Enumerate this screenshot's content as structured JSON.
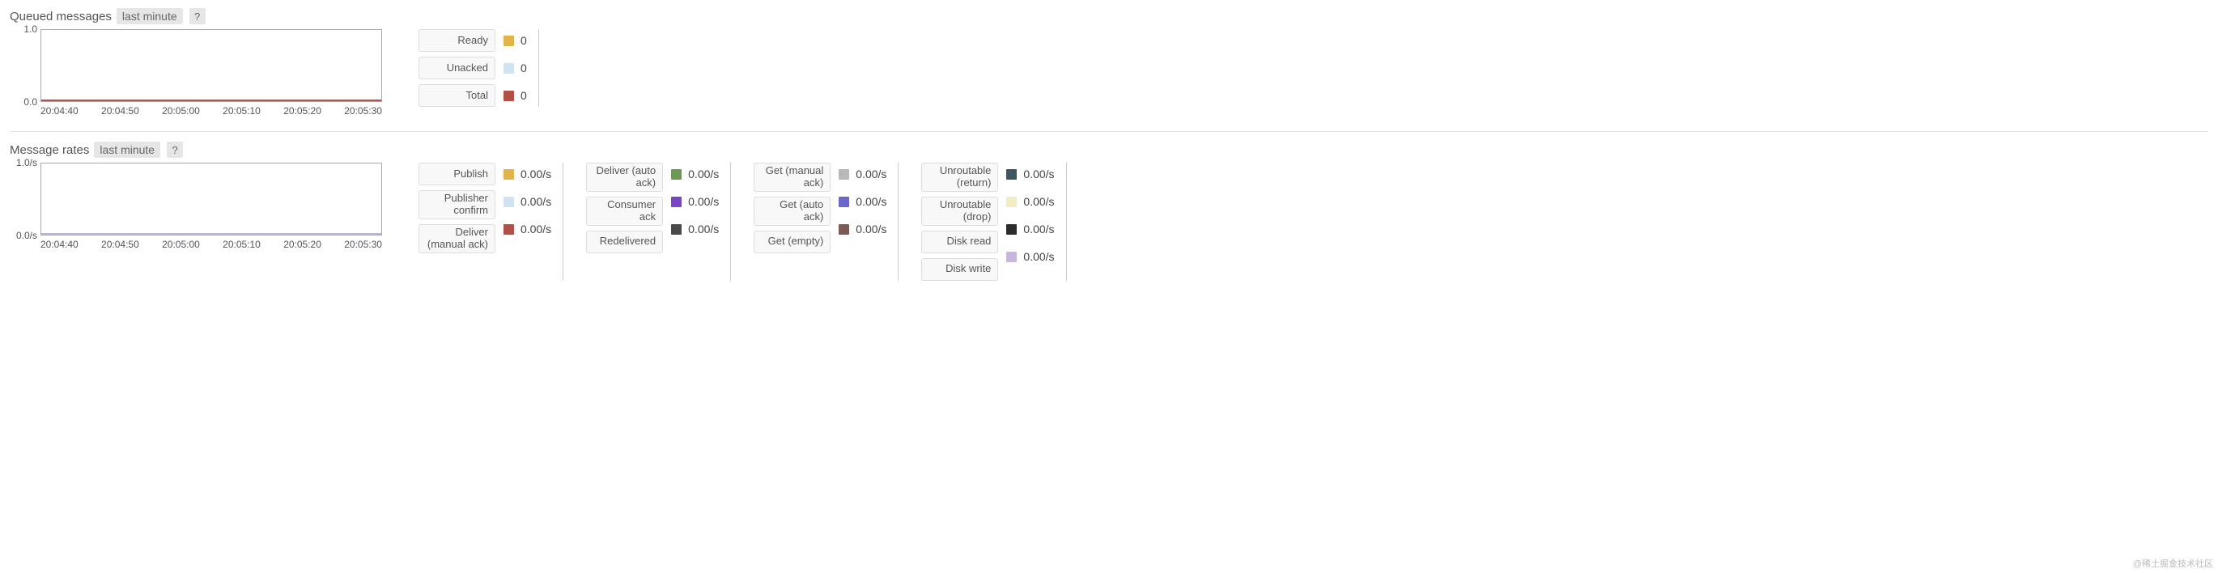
{
  "queued": {
    "title": "Queued messages",
    "range_tag": "last minute",
    "help": "?",
    "y_top": "1.0",
    "y_bottom": "0.0",
    "x_ticks": [
      "20:04:40",
      "20:04:50",
      "20:05:00",
      "20:05:10",
      "20:05:20",
      "20:05:30"
    ],
    "legend": [
      {
        "label": "Ready",
        "value": "0",
        "color": "#e1b44b"
      },
      {
        "label": "Unacked",
        "value": "0",
        "color": "#cfe3f0"
      },
      {
        "label": "Total",
        "value": "0",
        "color": "#b35045"
      }
    ]
  },
  "rates": {
    "title": "Message rates",
    "range_tag": "last minute",
    "help": "?",
    "y_top": "1.0/s",
    "y_bottom": "0.0/s",
    "x_ticks": [
      "20:04:40",
      "20:04:50",
      "20:05:00",
      "20:05:10",
      "20:05:20",
      "20:05:30"
    ],
    "columns": [
      [
        {
          "label": "Publish",
          "value": "0.00/s",
          "color": "#e1b44b"
        },
        {
          "label": "Publisher confirm",
          "value": "0.00/s",
          "color": "#cfe3f0"
        },
        {
          "label": "Deliver (manual ack)",
          "value": "0.00/s",
          "color": "#b35045"
        }
      ],
      [
        {
          "label": "Deliver (auto ack)",
          "value": "0.00/s",
          "color": "#6a9a4e"
        },
        {
          "label": "Consumer ack",
          "value": "0.00/s",
          "color": "#7a45c9"
        },
        {
          "label": "Redelivered",
          "value": "0.00/s",
          "color": "#4a4a4a"
        }
      ],
      [
        {
          "label": "Get (manual ack)",
          "value": "0.00/s",
          "color": "#b8b8b8"
        },
        {
          "label": "Get (auto ack)",
          "value": "0.00/s",
          "color": "#6b66c9"
        },
        {
          "label": "Get (empty)",
          "value": "0.00/s",
          "color": "#7d5a52"
        }
      ],
      [
        {
          "label": "Unroutable (return)",
          "value": "0.00/s",
          "color": "#3f5660"
        },
        {
          "label": "Unroutable (drop)",
          "value": "0.00/s",
          "color": "#f2edc2"
        },
        {
          "label": "Disk read",
          "value": "0.00/s",
          "color": "#2c2c2c"
        },
        {
          "label": "Disk write",
          "value": "0.00/s",
          "color": "#c9b6e0"
        }
      ]
    ]
  },
  "watermark": "@稀土掘金技术社区",
  "chart_data": [
    {
      "type": "line",
      "title": "Queued messages",
      "xlabel": "",
      "ylabel": "",
      "x": [
        "20:04:40",
        "20:04:50",
        "20:05:00",
        "20:05:10",
        "20:05:20",
        "20:05:30"
      ],
      "ylim": [
        0.0,
        1.0
      ],
      "series": [
        {
          "name": "Ready",
          "values": [
            0,
            0,
            0,
            0,
            0,
            0
          ]
        },
        {
          "name": "Unacked",
          "values": [
            0,
            0,
            0,
            0,
            0,
            0
          ]
        },
        {
          "name": "Total",
          "values": [
            0,
            0,
            0,
            0,
            0,
            0
          ]
        }
      ]
    },
    {
      "type": "line",
      "title": "Message rates",
      "xlabel": "",
      "ylabel": "per second",
      "x": [
        "20:04:40",
        "20:04:50",
        "20:05:00",
        "20:05:10",
        "20:05:20",
        "20:05:30"
      ],
      "ylim": [
        0.0,
        1.0
      ],
      "series": [
        {
          "name": "Publish",
          "values": [
            0,
            0,
            0,
            0,
            0,
            0
          ]
        },
        {
          "name": "Publisher confirm",
          "values": [
            0,
            0,
            0,
            0,
            0,
            0
          ]
        },
        {
          "name": "Deliver (manual ack)",
          "values": [
            0,
            0,
            0,
            0,
            0,
            0
          ]
        },
        {
          "name": "Deliver (auto ack)",
          "values": [
            0,
            0,
            0,
            0,
            0,
            0
          ]
        },
        {
          "name": "Consumer ack",
          "values": [
            0,
            0,
            0,
            0,
            0,
            0
          ]
        },
        {
          "name": "Redelivered",
          "values": [
            0,
            0,
            0,
            0,
            0,
            0
          ]
        },
        {
          "name": "Get (manual ack)",
          "values": [
            0,
            0,
            0,
            0,
            0,
            0
          ]
        },
        {
          "name": "Get (auto ack)",
          "values": [
            0,
            0,
            0,
            0,
            0,
            0
          ]
        },
        {
          "name": "Get (empty)",
          "values": [
            0,
            0,
            0,
            0,
            0,
            0
          ]
        },
        {
          "name": "Unroutable (return)",
          "values": [
            0,
            0,
            0,
            0,
            0,
            0
          ]
        },
        {
          "name": "Unroutable (drop)",
          "values": [
            0,
            0,
            0,
            0,
            0,
            0
          ]
        },
        {
          "name": "Disk read",
          "values": [
            0,
            0,
            0,
            0,
            0,
            0
          ]
        },
        {
          "name": "Disk write",
          "values": [
            0,
            0,
            0,
            0,
            0,
            0
          ]
        }
      ]
    }
  ]
}
